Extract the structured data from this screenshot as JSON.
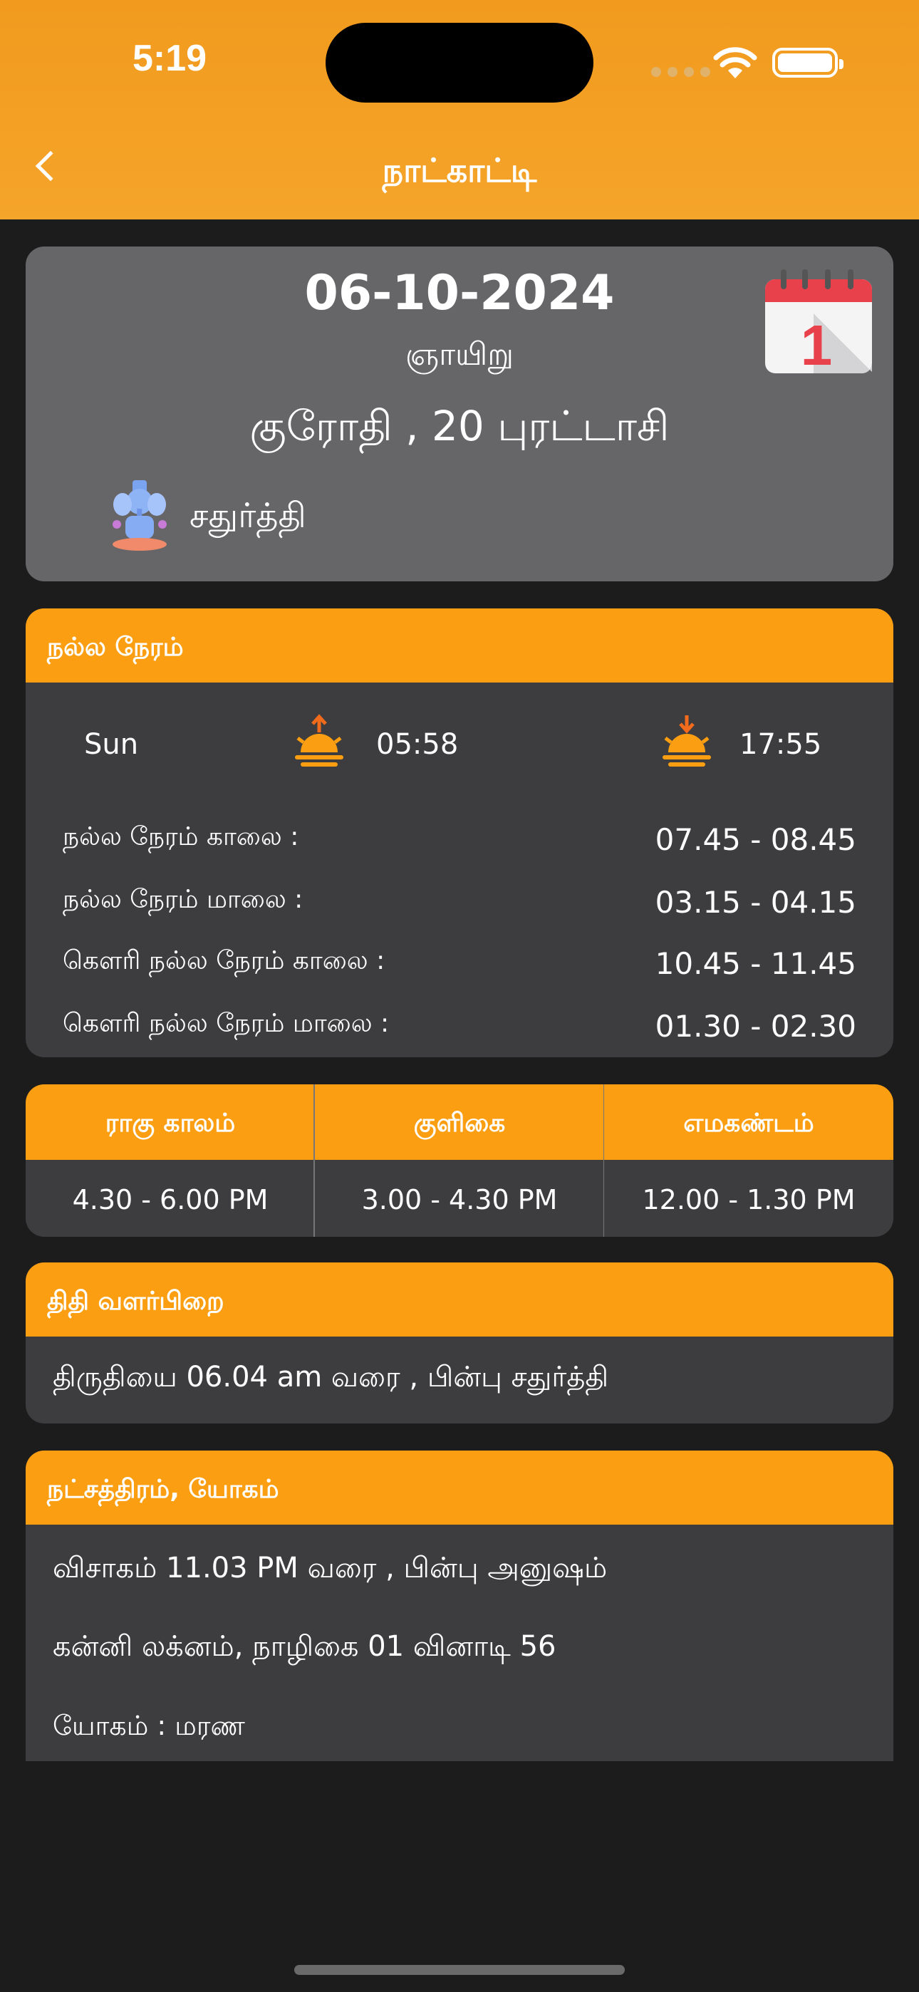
{
  "status_bar": {
    "time": "5:19"
  },
  "nav": {
    "title": "நாட்காட்டி"
  },
  "date_card": {
    "date": "06-10-2024",
    "day": "ஞாயிறு",
    "tamil_date": "குரோதி , 20 புரட்டாசி",
    "thithi": "சதுர்த்தி",
    "calendar_icon_number": "1"
  },
  "nalla_neram": {
    "header": "நல்ல நேரம்",
    "day_label": "Sun",
    "sunrise": "05:58",
    "sunset": "17:55",
    "rows": [
      {
        "label": "நல்ல நேரம் காலை :",
        "value": "07.45 - 08.45"
      },
      {
        "label": "நல்ல நேரம் மாலை :",
        "value": "03.15 - 04.15"
      },
      {
        "label": "கௌரி நல்ல நேரம் காலை :",
        "value": "10.45 - 11.45"
      },
      {
        "label": "கௌரி நல்ல நேரம் மாலை :",
        "value": "01.30 - 02.30"
      }
    ]
  },
  "kalam": {
    "columns": [
      {
        "header": "ராகு காலம்",
        "value": "4.30 - 6.00 PM"
      },
      {
        "header": "குளிகை",
        "value": "3.00 - 4.30 PM"
      },
      {
        "header": "எமகண்டம்",
        "value": "12.00 - 1.30 PM"
      }
    ]
  },
  "thithi_section": {
    "header": "திதி வளர்பிறை",
    "text": "திருதியை 06.04 am வரை , பின்பு சதுர்த்தி"
  },
  "nakshatra_section": {
    "header": "நட்சத்திரம், யோகம்",
    "line1": "விசாகம் 11.03 PM வரை , பின்பு அனுஷம்",
    "line2": "கன்னி லக்னம், நாழிகை 01 வினாடி 56",
    "line3": "யோகம் :  மரண"
  },
  "colors": {
    "accent": "#fb9e12",
    "header": "#f19a1e",
    "card": "#666668",
    "section": "#3d3d3f",
    "background": "#1c1c1c"
  }
}
